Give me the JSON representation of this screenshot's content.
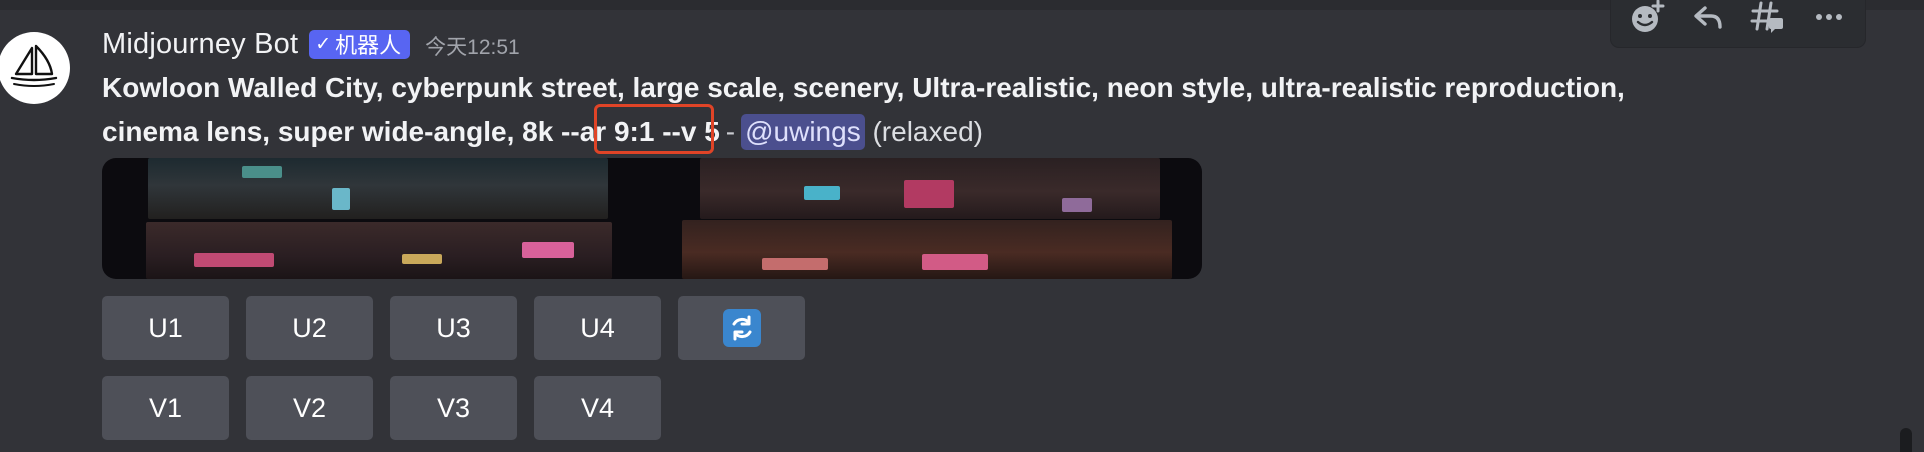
{
  "message": {
    "author": "Midjourney Bot",
    "bot_tag": "机器人",
    "timestamp": "今天12:51",
    "prompt_line1": "Kowloon Walled City, cyberpunk street, large scale, scenery, Ultra-realistic, neon style, ultra-realistic reproduction,",
    "prompt_line2_text": "cinema lens, super wide-angle, 8k --ar 9:1 --v 5",
    "separator": "-",
    "mention": "@uwings",
    "mode": "(relaxed)"
  },
  "buttons": {
    "upscale": [
      "U1",
      "U2",
      "U3",
      "U4"
    ],
    "variation": [
      "V1",
      "V2",
      "V3",
      "V4"
    ]
  },
  "icons": {
    "avatar": "sailboat-logo-icon",
    "reroll": "reroll-icon",
    "toolbar": [
      "add-reaction-icon",
      "reply-icon",
      "create-thread-icon",
      "more-icon"
    ]
  },
  "colors": {
    "background": "#323338",
    "button": "#4e5058",
    "bot_tag": "#5865f2",
    "mention_bg": "#4b4f8e",
    "highlight_border": "#e04427",
    "reroll": "#3a86ce"
  }
}
